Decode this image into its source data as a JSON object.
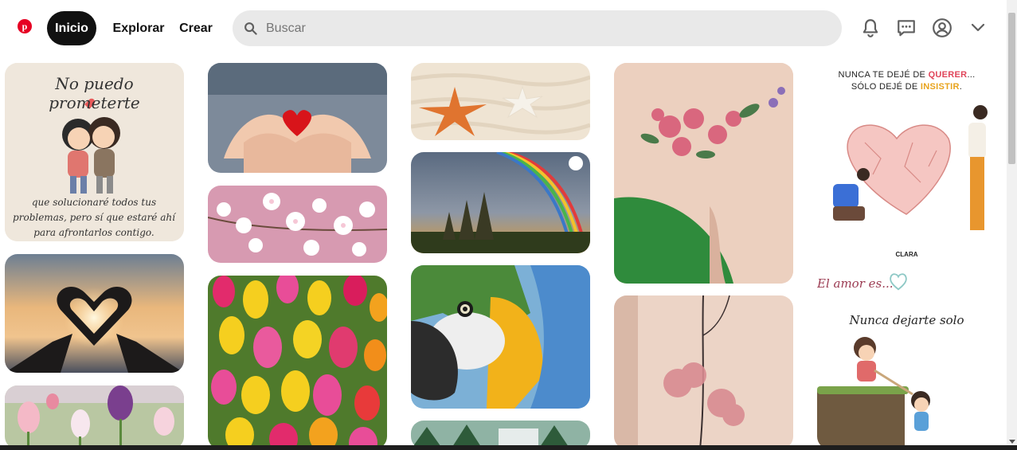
{
  "header": {
    "nav": {
      "home": "Inicio",
      "explore": "Explorar",
      "create": "Crear"
    },
    "search": {
      "placeholder": "Buscar",
      "value": ""
    },
    "icons": [
      "pinterest-logo",
      "search-icon",
      "bell-icon",
      "messages-icon",
      "user-icon",
      "chevron-down-icon"
    ]
  },
  "pins": {
    "p1": {
      "title": "No puedo prometerte",
      "caption": "que solucionaré todos tus problemas, pero sí que estaré ahí para afrontarlos contigo."
    },
    "p16": {
      "line1a": "NUNCA TE DEJÉ DE ",
      "line1b": "QUERER",
      "line1c": "...",
      "line2a": "SÓLO DEJÉ DE ",
      "line2b": "INSISTIR",
      "line2c": ".",
      "tag": "CLARA"
    },
    "p17": {
      "title": "El amor es..."
    },
    "p18": {
      "title": "Nunca dejarte solo"
    }
  },
  "colors": {
    "accent": "#e60023",
    "active_nav": "#111111",
    "search_bg": "#e9e9e9",
    "highlight_red": "#e0455a",
    "highlight_orange": "#e8a31c"
  }
}
